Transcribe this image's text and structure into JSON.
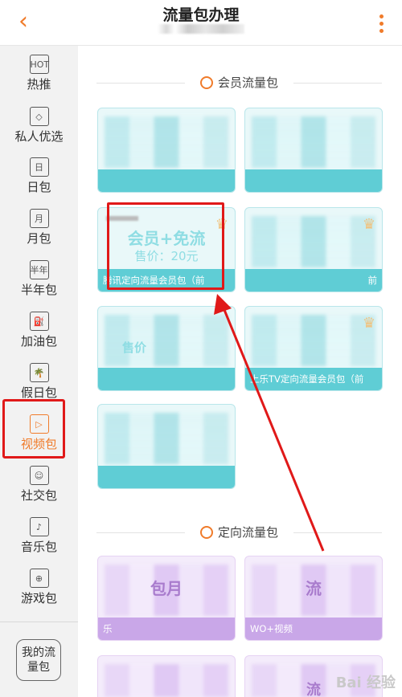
{
  "header": {
    "back_icon": "chevron-left-icon",
    "title": "流量包办理",
    "more_icon": "more-vertical-icon"
  },
  "sidebar": {
    "items": [
      {
        "label": "热推",
        "icon": "HOT",
        "icon_name": "hot-icon"
      },
      {
        "label": "私人优选",
        "icon": "◇",
        "icon_name": "diamond-icon"
      },
      {
        "label": "日包",
        "icon": "日",
        "icon_name": "day-calendar-icon"
      },
      {
        "label": "月包",
        "icon": "月",
        "icon_name": "month-calendar-icon"
      },
      {
        "label": "半年包",
        "icon": "半年",
        "icon_name": "half-year-icon"
      },
      {
        "label": "加油包",
        "icon": "⛽",
        "icon_name": "fuel-icon"
      },
      {
        "label": "假日包",
        "icon": "🌴",
        "icon_name": "palm-tree-icon"
      },
      {
        "label": "视频包",
        "icon": "▷",
        "icon_name": "video-play-icon"
      },
      {
        "label": "社交包",
        "icon": "☺",
        "icon_name": "chat-icon"
      },
      {
        "label": "音乐包",
        "icon": "♪",
        "icon_name": "music-icon"
      },
      {
        "label": "游戏包",
        "icon": "⊕",
        "icon_name": "gamepad-icon"
      }
    ],
    "active_index": 7,
    "my_flow": "我的流量包"
  },
  "sections": {
    "member": {
      "title": "会员流量包"
    },
    "directed": {
      "title": "定向流量包"
    }
  },
  "cards": {
    "featured": {
      "main": "会员+免流",
      "price": "售价：20元",
      "band": "腾讯定向流量会员包（前"
    },
    "r2c2_band": "前",
    "r3c1_main": "售价",
    "r3c2_band": "上乐TV定向流量会员包（前",
    "r5c1_main": "包月",
    "r5c1_band": "乐",
    "r5c2_main": "流",
    "r5c2_band": "WO+视频",
    "r6c2_main": "流"
  },
  "colors": {
    "accent": "#f07b2a",
    "highlight": "#e01919",
    "teal": "#5fcdd5",
    "purple": "#c9a7e8"
  },
  "watermark": "Bai 经验"
}
